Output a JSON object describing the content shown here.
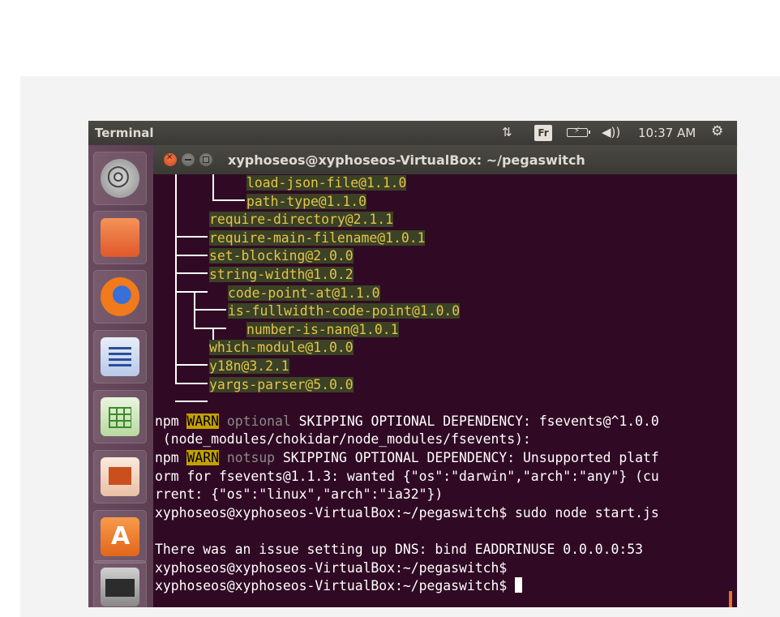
{
  "topbar": {
    "app_title": "Terminal",
    "keyboard_layout": "Fr",
    "clock": "10:37 AM",
    "icons": [
      "network-icon",
      "keyboard-layout-icon",
      "battery-icon",
      "volume-icon",
      "gear-icon"
    ]
  },
  "launcher": {
    "items": [
      "ubuntu-dash",
      "files",
      "firefox",
      "libreoffice-writer",
      "libreoffice-calc",
      "libreoffice-impress",
      "ubuntu-software",
      "terminal"
    ]
  },
  "window": {
    "title": "xyphoseos@xyphoseos-VirtualBox: ~/pegaswitch"
  },
  "terminal": {
    "tree_items": [
      {
        "label": "load-json-file@1.1.0"
      },
      {
        "label": "path-type@1.1.0"
      },
      {
        "label": "require-directory@2.1.1"
      },
      {
        "label": "require-main-filename@1.0.1"
      },
      {
        "label": "set-blocking@2.0.0"
      },
      {
        "label": "string-width@1.0.2"
      },
      {
        "label": "code-point-at@1.1.0"
      },
      {
        "label": "is-fullwidth-code-point@1.0.0"
      },
      {
        "label": "number-is-nan@1.0.1"
      },
      {
        "label": "which-module@1.0.0"
      },
      {
        "label": "y18n@3.2.1"
      },
      {
        "label": "yargs-parser@5.0.0"
      }
    ],
    "warn1": {
      "prefix": "npm",
      "level": "WARN",
      "tag": "optional",
      "message": " SKIPPING OPTIONAL DEPENDENCY: fsevents@^1.0.0",
      "continuation": " (node_modules/chokidar/node_modules/fsevents):"
    },
    "warn2": {
      "prefix": "npm",
      "level": "WARN",
      "tag": "notsup",
      "message": " SKIPPING OPTIONAL DEPENDENCY: Unsupported platf",
      "continuation1": "orm for fsevents@1.1.3: wanted {\"os\":\"darwin\",\"arch\":\"any\"} (cu",
      "continuation2": "rrent: {\"os\":\"linux\",\"arch\":\"ia32\"})"
    },
    "command_line": "xyphoseos@xyphoseos-VirtualBox:~/pegaswitch$ sudo node start.js",
    "dns_error": "There was an issue setting up DNS: bind EADDRINUSE 0.0.0.0:53",
    "prompt1": "xyphoseos@xyphoseos-VirtualBox:~/pegaswitch$",
    "prompt2": "xyphoseos@xyphoseos-VirtualBox:~/pegaswitch$ "
  }
}
